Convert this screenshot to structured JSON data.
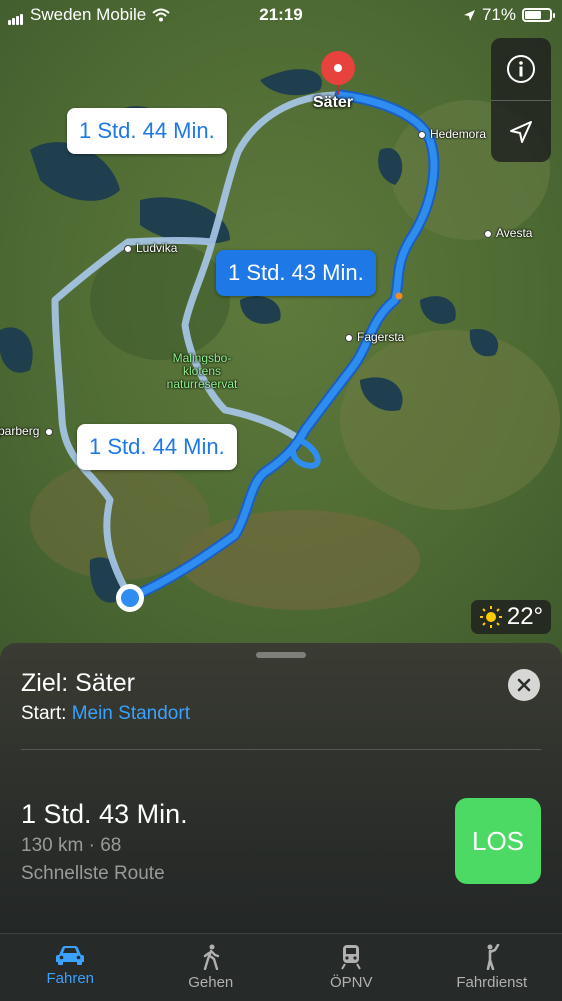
{
  "status_bar": {
    "carrier": "Sweden Mobile",
    "time": "21:19",
    "battery": "71%",
    "battery_level": 0.71
  },
  "map": {
    "destination_label": "Säter",
    "cities": [
      {
        "name": "Hedemora"
      },
      {
        "name": "Ludvika"
      },
      {
        "name": "Avesta"
      },
      {
        "name": "Fagersta"
      },
      {
        "name": "parberg"
      }
    ],
    "reserve_label": "Malingsbo-\nklotens\nnaturreservat",
    "route_callouts": {
      "alt_north": "1 Std. 44 Min.",
      "main": "1 Std. 43 Min.",
      "alt_south": "1 Std. 44 Min."
    },
    "controls": {
      "info_icon": "info-icon",
      "location_icon": "location-arrow-icon"
    },
    "weather": {
      "icon": "sun-icon",
      "temperature": "22°"
    },
    "colors": {
      "main_route": "#1e78e6",
      "alt_route": "#a9c8ea",
      "pin": "#e8423c"
    }
  },
  "sheet": {
    "destination_title": "Ziel: Säter",
    "start_label": "Start:",
    "start_value": "Mein Standort",
    "route": {
      "duration": "1 Std. 43 Min.",
      "meta": "130 km · 68",
      "description": "Schnellste Route"
    },
    "go_label": "LOS"
  },
  "tabs": [
    {
      "label": "Fahren",
      "icon": "car-icon",
      "active": true
    },
    {
      "label": "Gehen",
      "icon": "walk-icon",
      "active": false
    },
    {
      "label": "ÖPNV",
      "icon": "train-icon",
      "active": false
    },
    {
      "label": "Fahrdienst",
      "icon": "rideshare-icon",
      "active": false
    }
  ],
  "colors": {
    "accent": "#3aa1ff",
    "go_button": "#4cd964"
  }
}
